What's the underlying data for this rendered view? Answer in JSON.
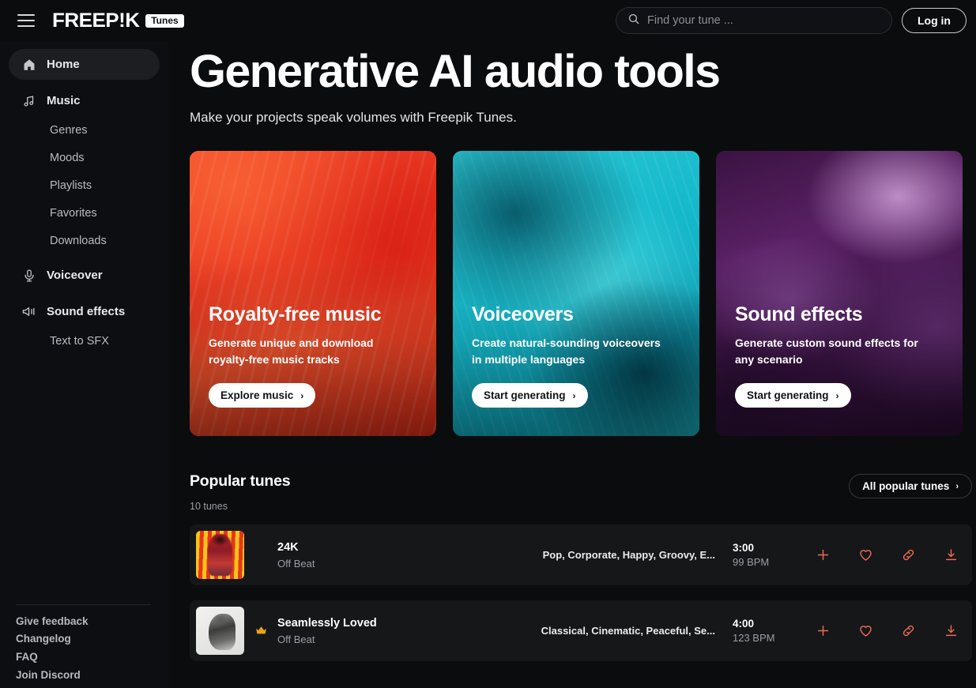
{
  "topbar": {
    "menu_icon": "hamburger-menu-icon",
    "logo_text": "FREEP!K",
    "logo_badge": "Tunes",
    "search": {
      "icon": "search-icon",
      "placeholder": "Find your tune ...",
      "value": ""
    },
    "login_label": "Log in"
  },
  "sidebar": {
    "items": [
      {
        "label": "Home",
        "icon": "home-icon",
        "type": "top",
        "active": true
      },
      {
        "label": "Music",
        "icon": "music-note-icon",
        "type": "top",
        "active": false
      },
      {
        "label": "Genres",
        "icon": "",
        "type": "sub",
        "active": false
      },
      {
        "label": "Moods",
        "icon": "",
        "type": "sub",
        "active": false
      },
      {
        "label": "Playlists",
        "icon": "",
        "type": "sub",
        "active": false
      },
      {
        "label": "Favorites",
        "icon": "",
        "type": "sub",
        "active": false
      },
      {
        "label": "Downloads",
        "icon": "",
        "type": "sub",
        "active": false
      },
      {
        "label": "Voiceover",
        "icon": "microphone-icon",
        "type": "top",
        "active": false
      },
      {
        "label": "Sound effects",
        "icon": "megaphone-icon",
        "type": "top",
        "active": false
      },
      {
        "label": "Text to SFX",
        "icon": "",
        "type": "sub",
        "active": false
      }
    ],
    "footer_links": [
      {
        "label": "Give feedback"
      },
      {
        "label": "Changelog"
      },
      {
        "label": "FAQ"
      },
      {
        "label": "Join Discord"
      }
    ]
  },
  "hero": {
    "title": "Generative AI audio tools",
    "subtitle": "Make your projects speak volumes with Freepik Tunes."
  },
  "cards": [
    {
      "title": "Royalty-free music",
      "description": "Generate unique and download royalty-free music tracks",
      "button_label": "Explore music",
      "chevron": "›",
      "theme": "red",
      "accent": "#e6321f"
    },
    {
      "title": "Voiceovers",
      "description": "Create natural-sounding voiceovers in multiple languages",
      "button_label": "Start generating",
      "chevron": "›",
      "theme": "teal",
      "accent": "#15b9cb"
    },
    {
      "title": "Sound effects",
      "description": "Generate custom sound effects for any scenario",
      "button_label": "Start generating",
      "chevron": "›",
      "theme": "purple",
      "accent": "#5a2165"
    }
  ],
  "popular": {
    "title": "Popular tunes",
    "count_label": "10 tunes",
    "all_label": "All popular tunes",
    "all_chevron": "›",
    "action_icons": [
      "plus-icon",
      "heart-icon",
      "link-icon",
      "download-icon"
    ],
    "action_color": "#ef6a53",
    "tracks": [
      {
        "name": "24K",
        "artist": "Off Beat",
        "tags": "Pop, Corporate, Happy, Groovy, E...",
        "duration": "3:00",
        "bpm": "99 BPM",
        "premium": false,
        "art": "art-24k"
      },
      {
        "name": "Seamlessly Loved",
        "artist": "Off Beat",
        "tags": "Classical, Cinematic, Peaceful, Se...",
        "duration": "4:00",
        "bpm": "123 BPM",
        "premium": true,
        "premium_icon": "crown-icon",
        "art": "art-seam"
      }
    ]
  }
}
